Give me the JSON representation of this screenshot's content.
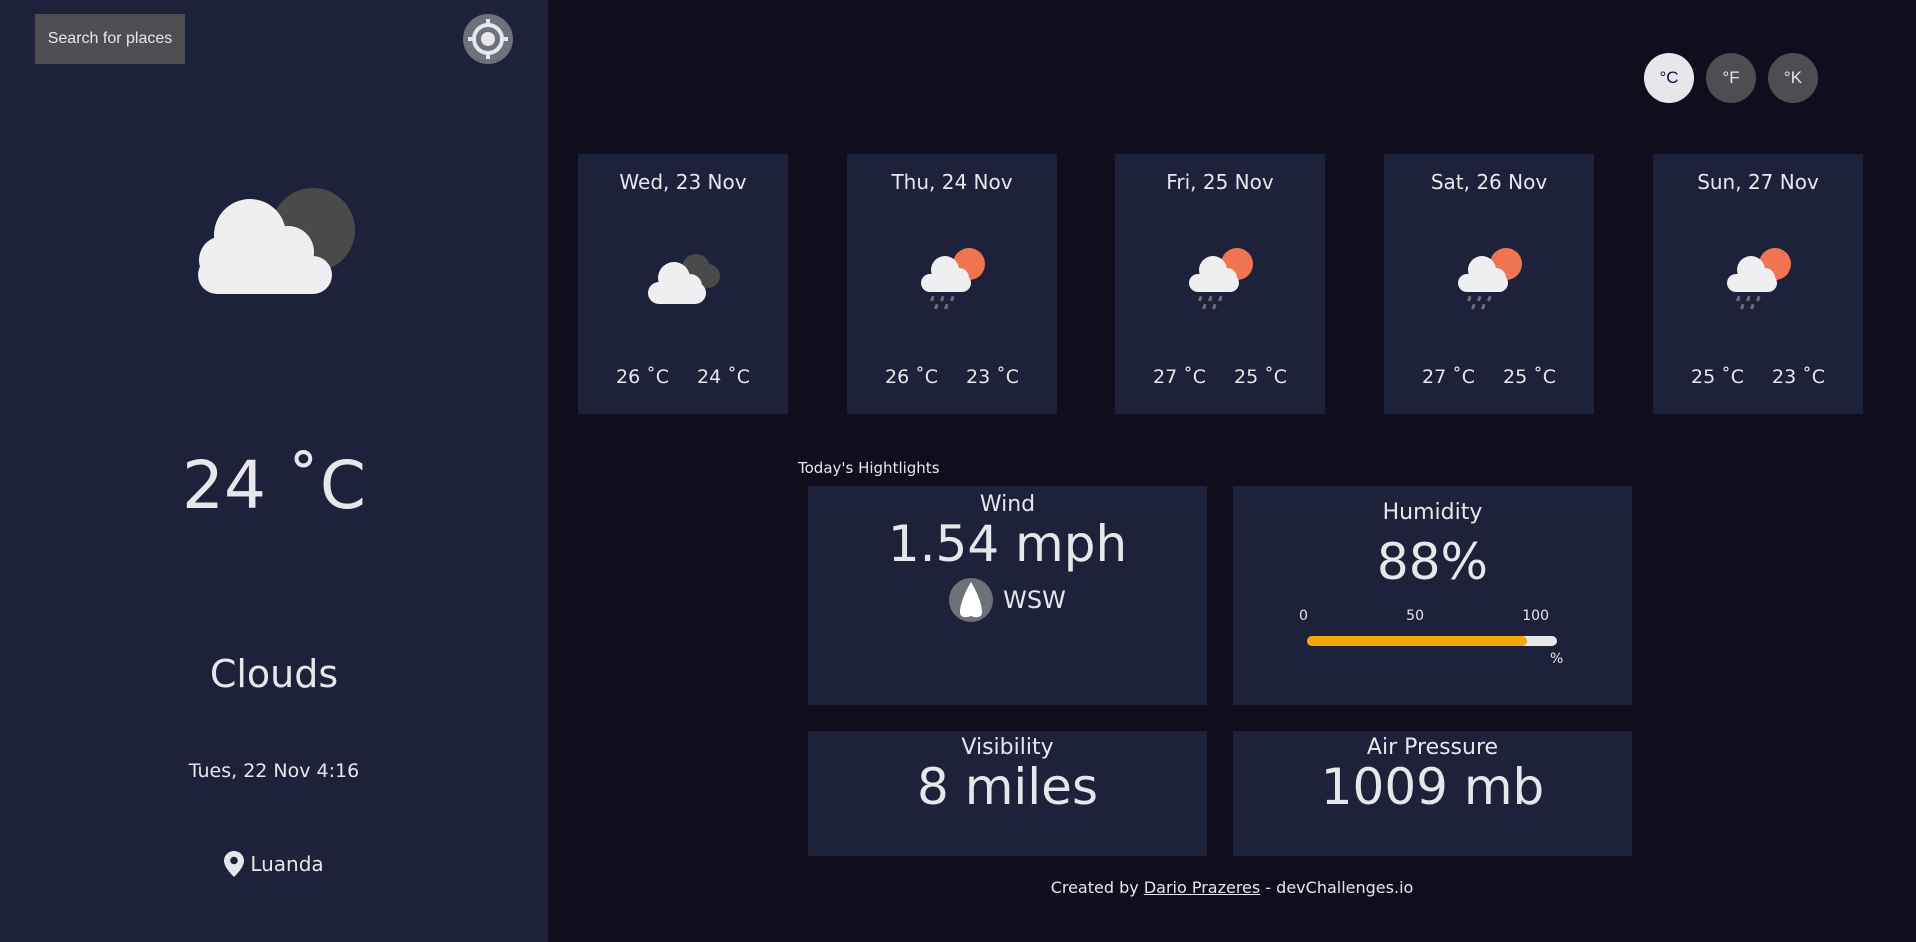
{
  "search": {
    "button_label": "Search for places"
  },
  "current": {
    "temperature": "24 ˚C",
    "description": "Clouds",
    "date": "Tues, 22 Nov 4:16",
    "location": "Luanda",
    "icon": "cloud-moon-icon"
  },
  "units": {
    "celsius": "°C",
    "fahrenheit": "°F",
    "kelvin": "°K",
    "active": "celsius"
  },
  "forecast": [
    {
      "date": "Wed, 23 Nov",
      "max": "26 ˚C",
      "min": "24 ˚C",
      "icon": "cloudy-icon"
    },
    {
      "date": "Thu, 24 Nov",
      "max": "26 ˚C",
      "min": "23 ˚C",
      "icon": "rain-sun-icon"
    },
    {
      "date": "Fri, 25 Nov",
      "max": "27 ˚C",
      "min": "25 ˚C",
      "icon": "rain-sun-icon"
    },
    {
      "date": "Sat, 26 Nov",
      "max": "27 ˚C",
      "min": "25 ˚C",
      "icon": "rain-sun-icon"
    },
    {
      "date": "Sun, 27 Nov",
      "max": "25 ˚C",
      "min": "23 ˚C",
      "icon": "rain-sun-icon"
    }
  ],
  "highlights": {
    "title": "Today's Hightlights",
    "wind": {
      "label": "Wind",
      "value": "1.54 mph",
      "direction": "WSW"
    },
    "humidity": {
      "label": "Humidity",
      "value": "88%",
      "percent": 88,
      "scale_min": "0",
      "scale_mid": "50",
      "scale_max": "100",
      "unit": "%"
    },
    "visibility": {
      "label": "Visibility",
      "value": "8 miles"
    },
    "pressure": {
      "label": "Air Pressure",
      "value": "1009 mb"
    }
  },
  "footer": {
    "prefix": "Created by ",
    "author": "Dario Prazeres",
    "suffix": " - devChallenges.io"
  },
  "colors": {
    "background": "#100e1d",
    "panel": "#1e213a",
    "accent_bar": "#f4a60b",
    "sun": "#ef7452"
  }
}
